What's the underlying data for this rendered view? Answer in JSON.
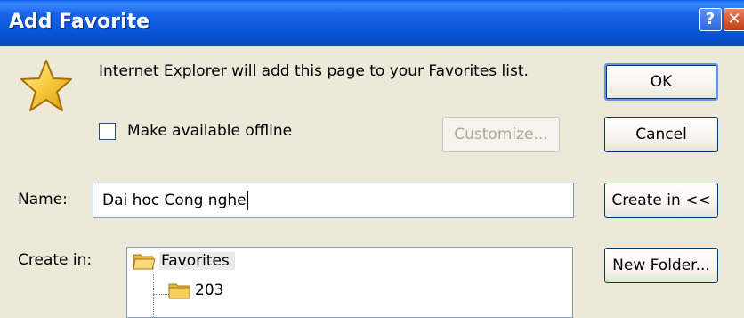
{
  "window": {
    "title": "Add Favorite",
    "help_glyph": "?",
    "close_glyph": "✕"
  },
  "message": "Internet Explorer will add this page to your Favorites list.",
  "offline": {
    "label": "Make available offline",
    "checked": false
  },
  "buttons": {
    "ok": "OK",
    "cancel": "Cancel",
    "customize": "Customize...",
    "create_in": "Create in <<",
    "new_folder": "New Folder..."
  },
  "name": {
    "label": "Name:",
    "value": "Dai hoc Cong nghe"
  },
  "create_in": {
    "label": "Create in:",
    "items": [
      {
        "label": "Favorites",
        "selected": true
      },
      {
        "label": "203",
        "selected": false
      }
    ]
  },
  "icons": {
    "dialog": "star-icon",
    "folder": "folder-icon"
  },
  "colors": {
    "titlebar": "#0756D8",
    "dialog_bg": "#ECE9D8",
    "button_border": "#003C74"
  }
}
